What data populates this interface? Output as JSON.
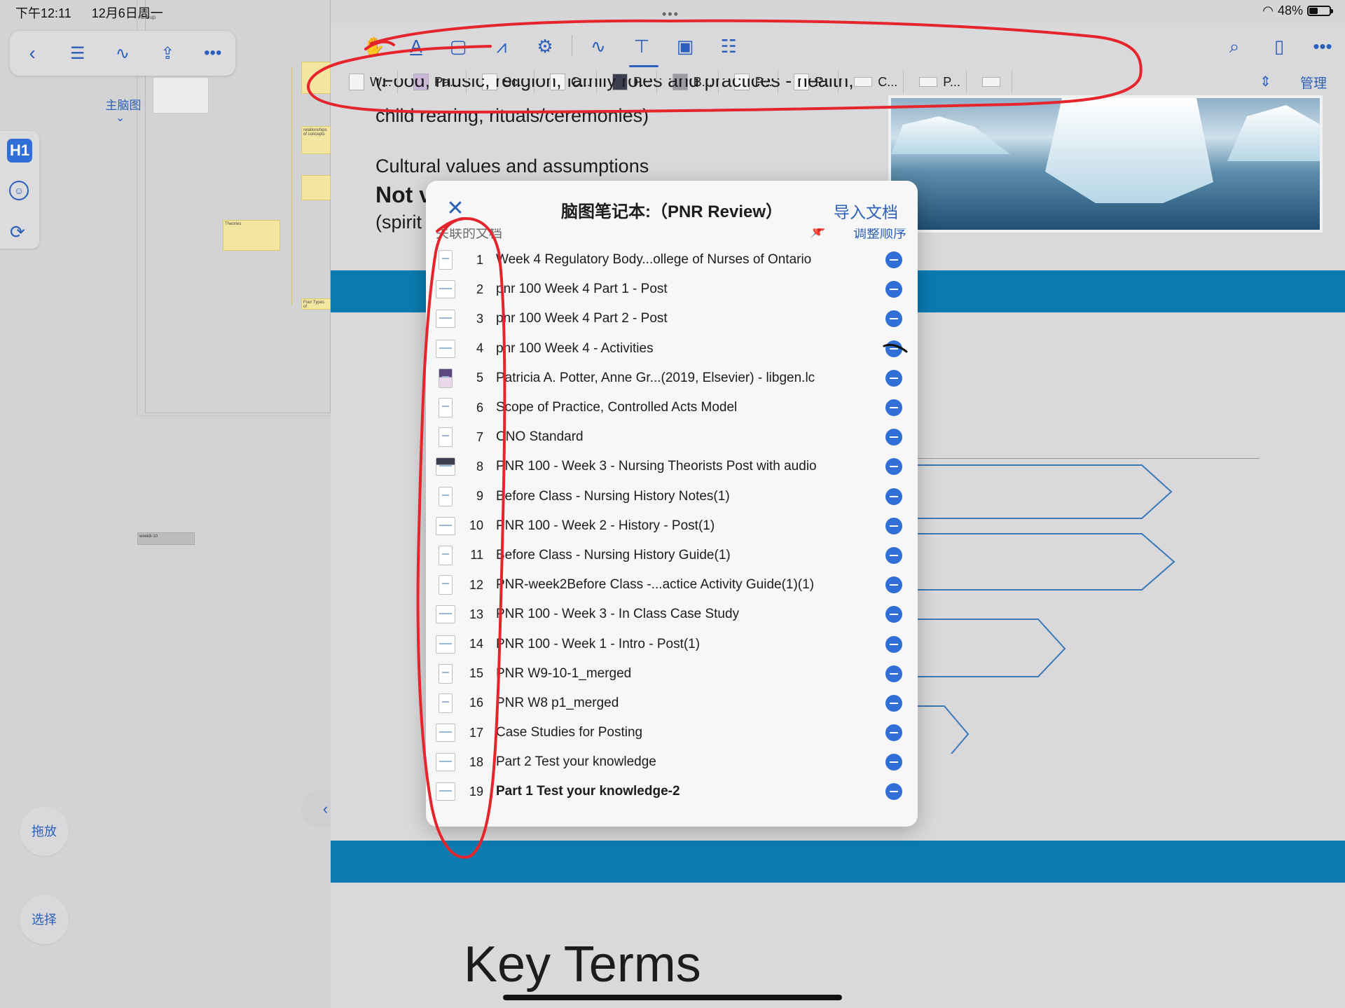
{
  "status_bar": {
    "time": "下午12:11",
    "date": "12月6日周一",
    "battery": "48%",
    "battery_level": 0.48
  },
  "mindmap_panel": {
    "toolbar_icons": [
      "back-chevron-icon",
      "list-icon",
      "ink-pen-icon",
      "share-icon",
      "more-icon"
    ],
    "label": "主脑图",
    "drag_button": "拖放",
    "select_button": "选择",
    "group_label": "Group",
    "node_week810": "week8-10",
    "node_theories": "Theories",
    "node_four_types": "Four Types of",
    "node_relationships": "relationships of concepts"
  },
  "doc_toolbar": {
    "tools": [
      "hand-icon",
      "text-highlight-icon",
      "rect-select-icon",
      "ink-chart-icon",
      "settings-gear-icon",
      "ink-pen-icon",
      "text-box-icon",
      "image-icon",
      "list-box-icon"
    ],
    "right_tools": [
      "search-icon",
      "bookmark-icon",
      "more-icon"
    ]
  },
  "doc_tabs": {
    "items": [
      "W...",
      "Pa...",
      "Sc...",
      "C...",
      "P...",
      "B...",
      "P...",
      "P...",
      "C...",
      "P...",
      ""
    ],
    "manage_label": "管理"
  },
  "slide": {
    "line1": "(Food, music, religion, family roles and practices - health,",
    "line2": "child rearing, rituals/ceremonies)",
    "heading_values": "Cultural values and assumptions",
    "bold_partial": "Not v",
    "paren_partial": "(spirit",
    "key_terms": "Key Terms"
  },
  "modal": {
    "title": "脑图笔记本:（PNR Review）",
    "import_label": "导入文档",
    "linked_docs_label": "关联的文档",
    "reorder_label": "调整顺序",
    "documents": [
      {
        "num": "1",
        "title": "Week 4  Regulatory Body...ollege of Nurses of Ontario",
        "thumb": "tall"
      },
      {
        "num": "2",
        "title": "pnr 100 Week 4 Part 1 - Post",
        "thumb": "wide"
      },
      {
        "num": "3",
        "title": "pnr 100 Week 4 Part 2 - Post",
        "thumb": "wide"
      },
      {
        "num": "4",
        "title": "pnr 100 Week 4 - Activities",
        "thumb": "wide"
      },
      {
        "num": "5",
        "title": "Patricia A. Potter, Anne Gr...(2019, Elsevier) - libgen.lc",
        "thumb": "color"
      },
      {
        "num": "6",
        "title": "Scope of Practice, Controlled Acts Model",
        "thumb": "tall"
      },
      {
        "num": "7",
        "title": "CNO Standard",
        "thumb": "tall"
      },
      {
        "num": "8",
        "title": "PNR 100 - Week 3 - Nursing Theorists Post with audio",
        "thumb": "dark"
      },
      {
        "num": "9",
        "title": "Before Class - Nursing History Notes(1)",
        "thumb": "tall"
      },
      {
        "num": "10",
        "title": "PNR 100 - Week 2 - History - Post(1)",
        "thumb": "wide"
      },
      {
        "num": "11",
        "title": "Before Class - Nursing History Guide(1)",
        "thumb": "tall"
      },
      {
        "num": "12",
        "title": "PNR-week2Before Class -...actice Activity Guide(1)(1)",
        "thumb": "tall"
      },
      {
        "num": "13",
        "title": "PNR 100 - Week 3 - In Class Case Study",
        "thumb": "wide"
      },
      {
        "num": "14",
        "title": "PNR 100 - Week 1 - Intro - Post(1)",
        "thumb": "wide"
      },
      {
        "num": "15",
        "title": "PNR W9-10-1_merged",
        "thumb": "tall"
      },
      {
        "num": "16",
        "title": "PNR W8 p1_merged",
        "thumb": "tall"
      },
      {
        "num": "17",
        "title": "Case Studies for Posting",
        "thumb": "wide"
      },
      {
        "num": "18",
        "title": "Part 2 Test your knowledge",
        "thumb": "wide"
      },
      {
        "num": "19",
        "title": "Part 1 Test your knowledge-2",
        "thumb": "wide",
        "bold": true
      }
    ]
  },
  "colors": {
    "accent": "#2b5fb9",
    "annotation_red": "#e5242b",
    "slide_band": "#0b7bb0"
  }
}
